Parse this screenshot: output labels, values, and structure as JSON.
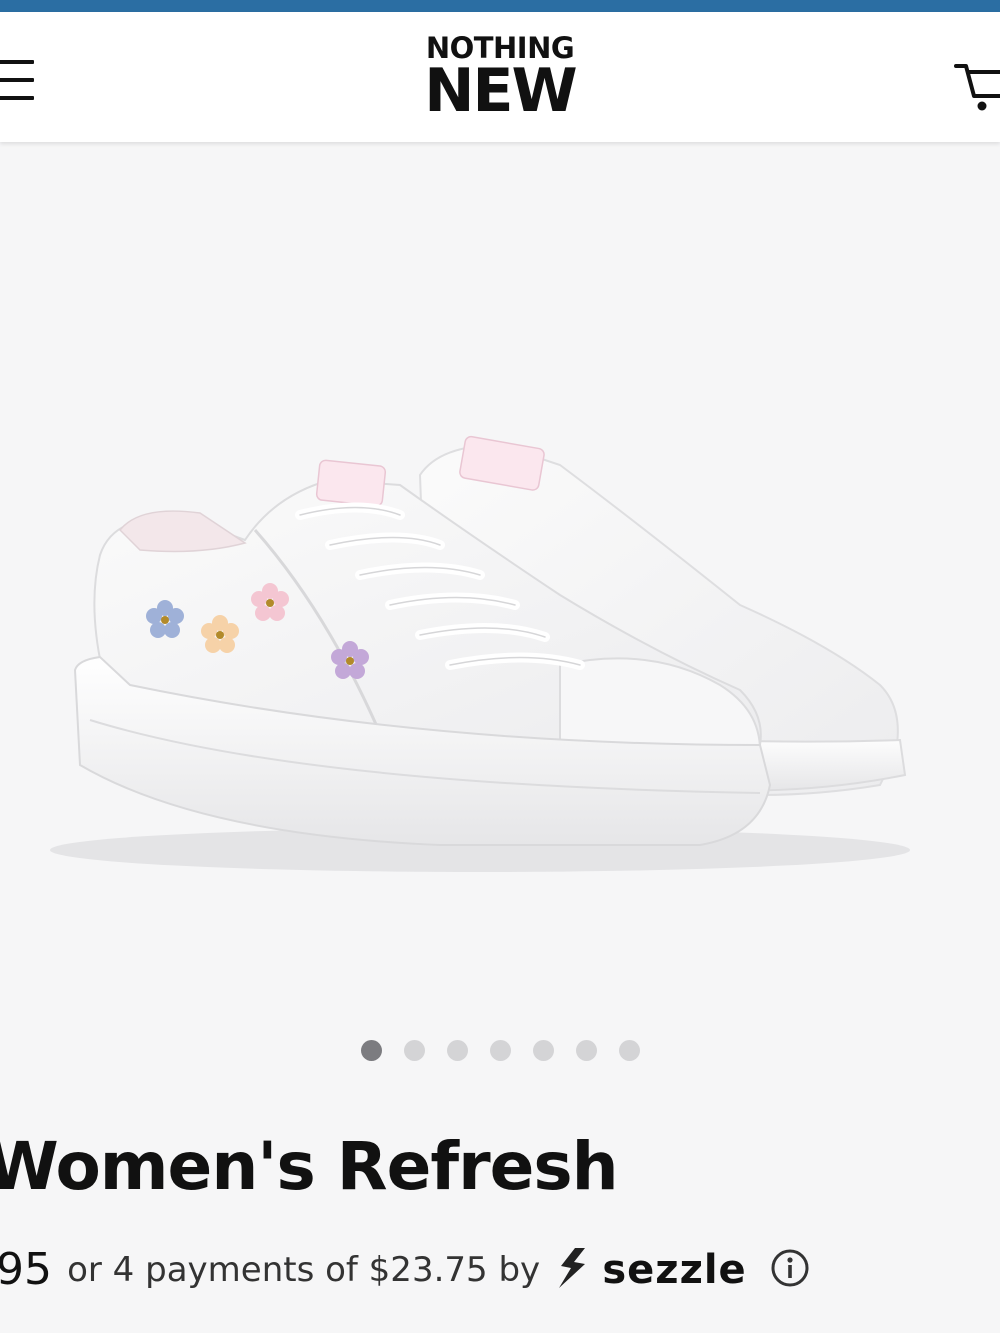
{
  "header": {
    "logo_line1": "NOTHING",
    "logo_line2": "NEW",
    "menu_icon": "hamburger-menu-icon",
    "cart_icon": "shopping-cart-icon"
  },
  "colors": {
    "top_strip": "#2b6ea3",
    "background": "#f6f6f7",
    "dot_active": "#7c7c80",
    "dot_inactive": "#d4d4d6"
  },
  "gallery": {
    "image_count": 7,
    "active_index": 0
  },
  "product": {
    "title": "Women's Refresh",
    "price": "95",
    "installment_text": "or 4 payments of $23.75 by",
    "sezzle_brand": "sezzle",
    "info_icon": "info-circle-icon"
  }
}
